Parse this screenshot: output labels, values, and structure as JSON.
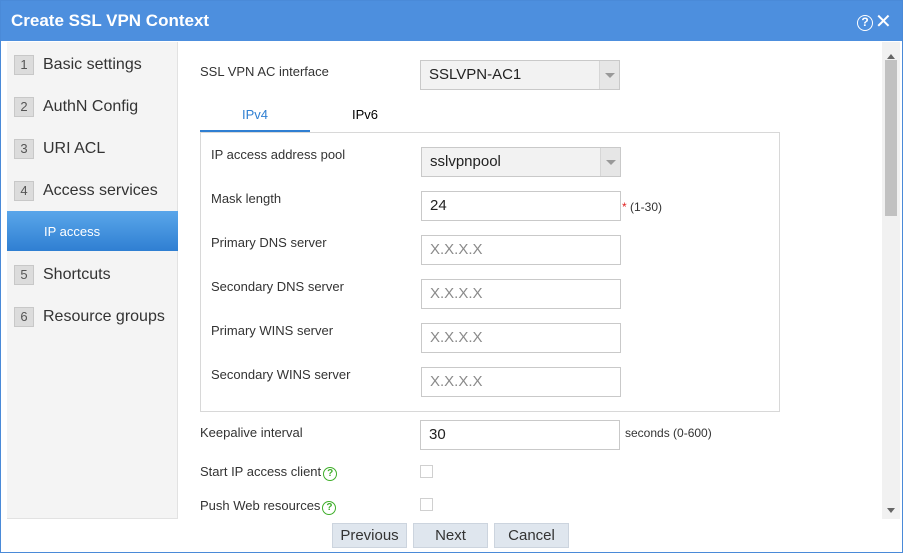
{
  "window": {
    "title": "Create SSL VPN Context",
    "help_icon": "?",
    "close_icon": "✕"
  },
  "sidebar": {
    "steps": [
      {
        "num": "1",
        "label": "Basic settings"
      },
      {
        "num": "2",
        "label": "AuthN Config"
      },
      {
        "num": "3",
        "label": "URI ACL"
      },
      {
        "num": "4",
        "label": "Access services"
      },
      {
        "num": "5",
        "label": "Shortcuts"
      },
      {
        "num": "6",
        "label": "Resource groups"
      }
    ],
    "substep": {
      "label": "IP access",
      "active": true
    }
  },
  "form": {
    "ac_interface": {
      "label": "SSL VPN AC interface",
      "value": "SSLVPN-AC1"
    },
    "tabs": [
      {
        "label": "IPv4",
        "active": true
      },
      {
        "label": "IPv6",
        "active": false
      }
    ],
    "pool": {
      "label": "IP access address pool",
      "value": "sslvpnpool"
    },
    "mask": {
      "label": "Mask length",
      "value": "24",
      "required": "*",
      "range": "(1-30)"
    },
    "primary_dns": {
      "label": "Primary DNS server",
      "placeholder": "X.X.X.X"
    },
    "secondary_dns": {
      "label": "Secondary DNS server",
      "placeholder": "X.X.X.X"
    },
    "primary_wins": {
      "label": "Primary WINS server",
      "placeholder": "X.X.X.X"
    },
    "secondary_wins": {
      "label": "Secondary WINS server",
      "placeholder": "X.X.X.X"
    },
    "keepalive": {
      "label": "Keepalive interval",
      "value": "30",
      "unit": "seconds (0-600)"
    },
    "start_client": {
      "label": "Start IP access client",
      "checked": false
    },
    "push_web": {
      "label": "Push Web resources",
      "checked": false
    }
  },
  "buttons": {
    "previous": "Previous",
    "next": "Next",
    "cancel": "Cancel"
  },
  "colors": {
    "titlebar": "#4d8fde",
    "active_step": "#2f7fd2",
    "help_icon": "#3fae2a"
  }
}
